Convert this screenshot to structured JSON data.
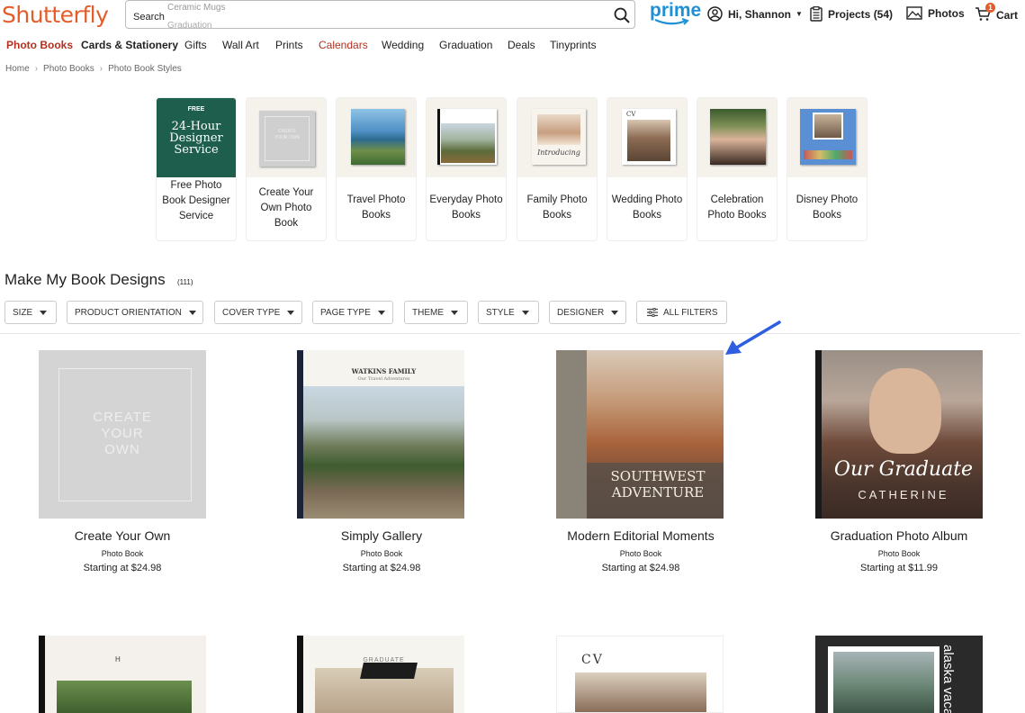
{
  "header": {
    "logo": "Shutterfly",
    "search_label": "Search",
    "search_hints": [
      "Ceramic Mugs",
      "Graduation"
    ],
    "prime_label": "prime",
    "user_greeting": "Hi, Shannon",
    "projects_label": "Projects (54)",
    "photos_label": "Photos",
    "cart_label": "Cart",
    "cart_count": "1"
  },
  "nav": {
    "items": [
      "Photo Books",
      "Cards & Stationery",
      "Gifts",
      "Wall Art",
      "Prints",
      "Calendars",
      "Wedding",
      "Graduation",
      "Deals",
      "Tinyprints"
    ]
  },
  "breadcrumb": {
    "items": [
      "Home",
      "Photo Books",
      "Photo Book Styles"
    ],
    "separator": "›"
  },
  "categories": {
    "items": [
      {
        "label": "Free Photo Book Designer Service",
        "image_text_top": "FREE",
        "image_text_main": "24-Hour Designer Service"
      },
      {
        "label": "Create Your Own Photo Book",
        "image_text_main": "CREATE YOUR OWN"
      },
      {
        "label": "Travel Photo Books"
      },
      {
        "label": "Everyday Photo Books"
      },
      {
        "label": "Family Photo Books",
        "image_text_main": "Introducing"
      },
      {
        "label": "Wedding Photo Books",
        "image_text_main": "CV"
      },
      {
        "label": "Celebration Photo Books"
      },
      {
        "label": "Disney Photo Books"
      }
    ]
  },
  "designs": {
    "title": "Make My Book Designs",
    "count": "(111)"
  },
  "filters": {
    "items": [
      "SIZE",
      "PRODUCT ORIENTATION",
      "COVER TYPE",
      "PAGE TYPE",
      "THEME",
      "STYLE",
      "DESIGNER"
    ],
    "all_filters": "ALL FILTERS"
  },
  "products": [
    {
      "title": "Create Your Own",
      "type": "Photo Book",
      "price": "Starting at $24.98",
      "cover_text": [
        "CREATE",
        "YOUR",
        "OWN"
      ]
    },
    {
      "title": "Simply Gallery",
      "type": "Photo Book",
      "price": "Starting at $24.98",
      "cover_text": [
        "WATKINS FAMILY",
        "Our Travel Adventures"
      ]
    },
    {
      "title": "Modern Editorial Moments",
      "type": "Photo Book",
      "price": "Starting at $24.98",
      "cover_text": [
        "SOUTHWEST",
        "ADVENTURE"
      ]
    },
    {
      "title": "Graduation Photo Album",
      "type": "Photo Book",
      "price": "Starting at $11.99",
      "cover_text": [
        "Our Graduate",
        "CATHERINE"
      ]
    }
  ],
  "row2": {
    "cover_texts": [
      "H",
      "GRADUATE",
      "CV",
      "alaska vaca"
    ]
  },
  "colors": {
    "brand_orange": "#e25d2b",
    "nav_accent": "#b5301e",
    "prime_blue": "#1f8fd6",
    "arrow_blue": "#2f5fe0"
  }
}
